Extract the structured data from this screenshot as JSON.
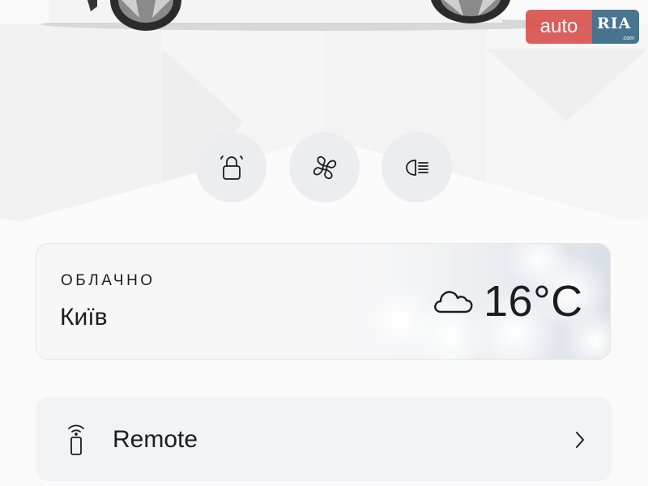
{
  "watermark": {
    "text_auto": "auto",
    "text_ria": "RIA",
    "text_com": ".com"
  },
  "quick_actions": [
    {
      "id": "lock",
      "icon": "lock-icon"
    },
    {
      "id": "climate",
      "icon": "fan-icon"
    },
    {
      "id": "lights",
      "icon": "headlights-icon"
    }
  ],
  "weather": {
    "condition": "ОБЛАЧНО",
    "city": "Київ",
    "temperature": "16°C",
    "icon": "cloud-icon"
  },
  "remote": {
    "label": "Remote",
    "icon": "remote-key-icon",
    "chevron": "chevron-right-icon"
  },
  "colors": {
    "button_bg": "#ebedf0",
    "card_border": "#e4e5e8",
    "text": "#1d1d1f",
    "logo_red": "#d9534f",
    "logo_blue": "#3a6a87"
  }
}
